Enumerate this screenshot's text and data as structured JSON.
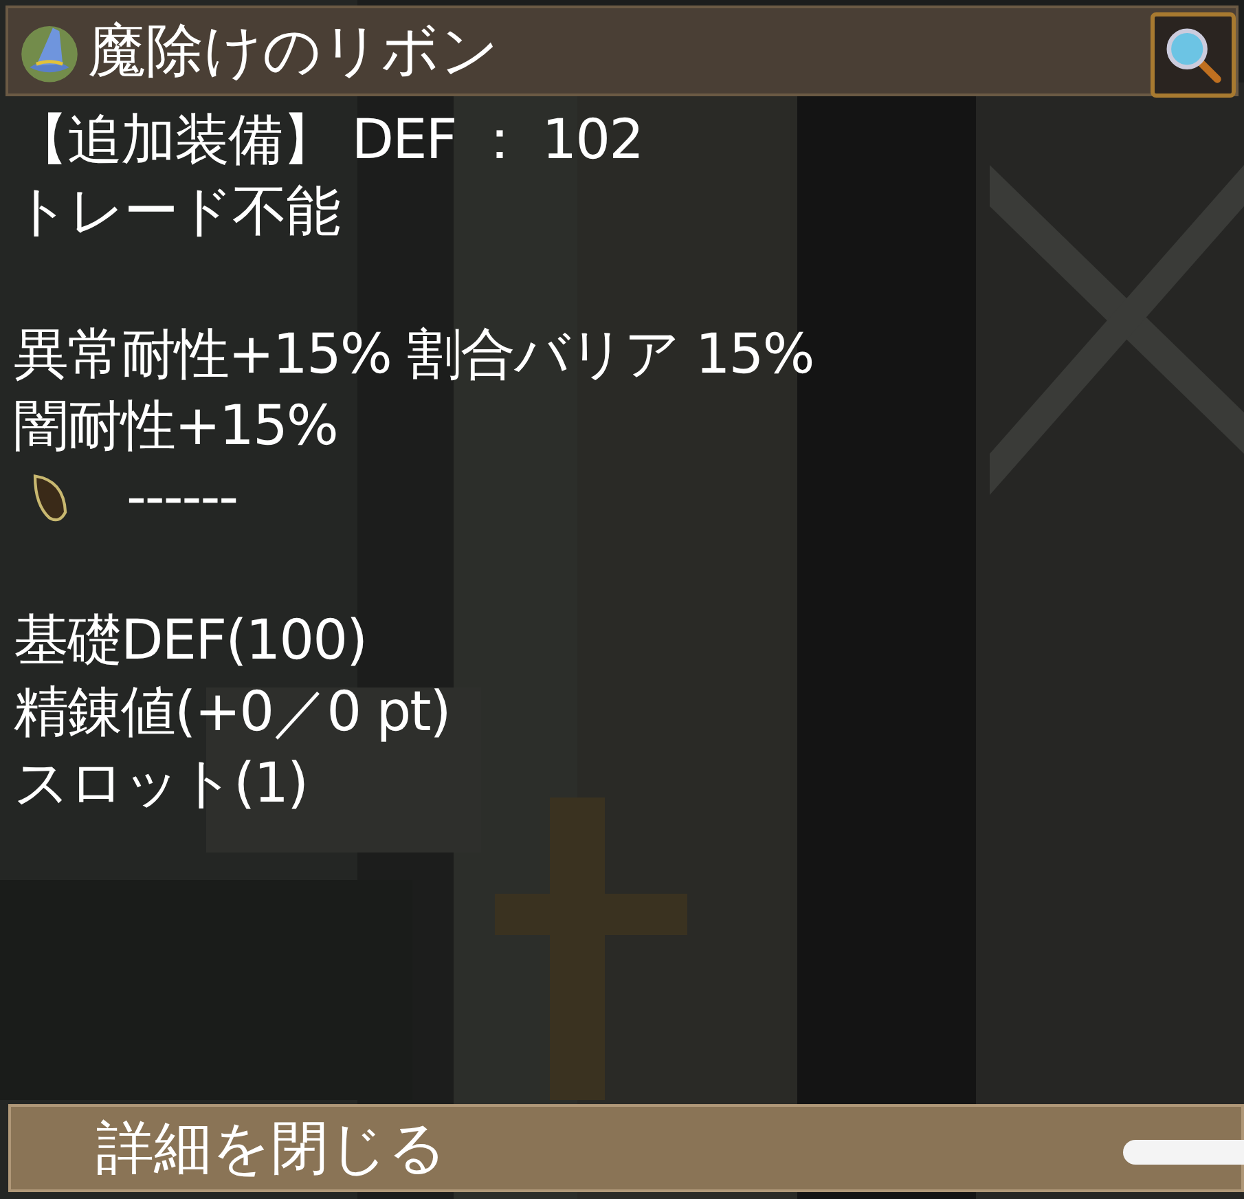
{
  "title_bar": {
    "title": "魔除けのリボン"
  },
  "description": {
    "lines": [
      {
        "kind": "text",
        "text": "【追加装備】 DEF ： 102"
      },
      {
        "kind": "text",
        "text": "トレード不能"
      },
      {
        "kind": "blank"
      },
      {
        "kind": "text",
        "text": "異常耐性+15% 割合バリア 15%"
      },
      {
        "kind": "text",
        "text": "闇耐性+15%"
      },
      {
        "kind": "slot",
        "text": "------"
      },
      {
        "kind": "blank"
      },
      {
        "kind": "text",
        "text": "基礎DEF(100)"
      },
      {
        "kind": "text",
        "text": "精錬値(+0／0 pt)"
      },
      {
        "kind": "text",
        "text": "スロット(1)"
      }
    ]
  },
  "close_bar": {
    "label": "詳細を閉じる"
  }
}
